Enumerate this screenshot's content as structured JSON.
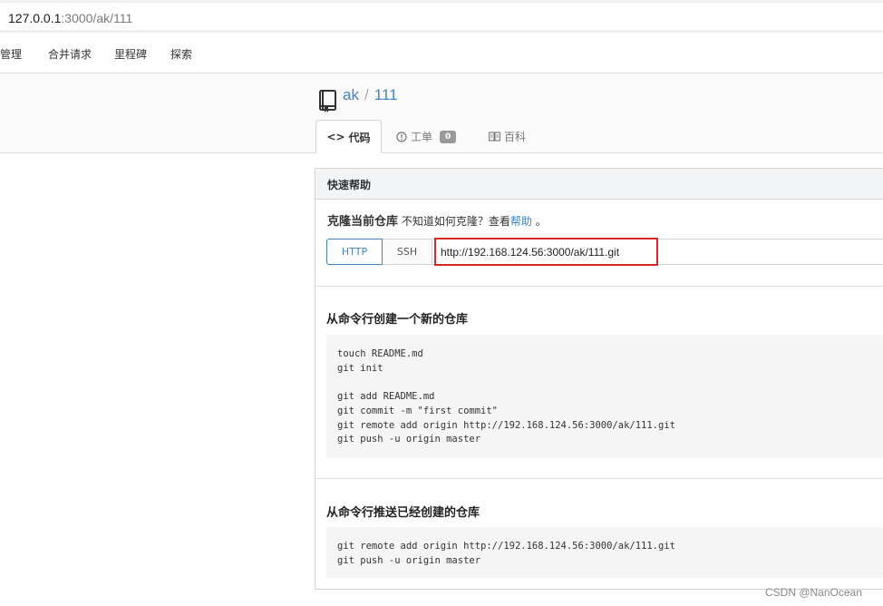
{
  "browser": {
    "url_host": "127.0.0.1",
    "url_path": ":3000/ak/111"
  },
  "nav": {
    "items": [
      "管理",
      "合并请求",
      "里程碑",
      "探索"
    ]
  },
  "repo": {
    "owner": "ak",
    "separator": "/",
    "name": "111",
    "icon": "book-icon"
  },
  "tabs": {
    "code": "代码",
    "issues": "工单",
    "issues_count": "0",
    "wiki": "百科"
  },
  "quick_help": {
    "header": "快速帮助",
    "clone_title": "克隆当前仓库",
    "clone_hint": "不知道如何克隆？查看",
    "help_link": "帮助",
    "clone_hint_end": "。",
    "http_label": "HTTP",
    "ssh_label": "SSH",
    "clone_url": "http://192.168.124.56:3000/ak/111.git",
    "new_repo_title": "从命令行创建一个新的仓库",
    "new_repo_lines": [
      "touch README.md",
      "git init",
      "",
      "git add README.md",
      "git commit -m \"first commit\"",
      "git remote add origin http://192.168.124.56:3000/ak/111.git",
      "git push -u origin master"
    ],
    "push_existing_title": "从命令行推送已经创建的仓库",
    "push_existing_lines": [
      "git remote add origin http://192.168.124.56:3000/ak/111.git",
      "git push -u origin master"
    ]
  },
  "watermark": "CSDN @NanOcean",
  "colors": {
    "link": "#4183c4",
    "highlight": "#d62728"
  }
}
